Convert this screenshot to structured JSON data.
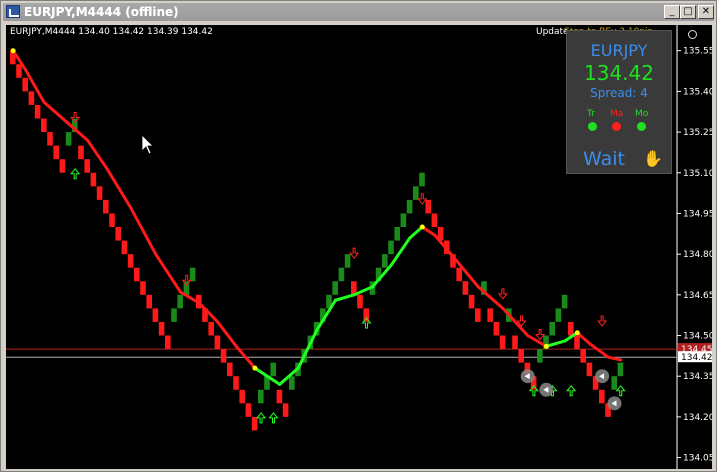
{
  "window": {
    "title": "EURJPY,M4444 (offline)",
    "buttons": {
      "minimize": "_",
      "maximize": "□",
      "close": "✕"
    }
  },
  "header_label": "EURJPY,M4444  134.40 134.42 134.39 134.42",
  "update_label": "Update",
  "update_overlay_text": "Stop to BEv 3 10pip",
  "panel": {
    "symbol": "EURJPY",
    "price": "134.42",
    "spread": "Spread: 4",
    "indicators": [
      {
        "label": "Tr",
        "color": "#1fe01f"
      },
      {
        "label": "Ma",
        "color": "#ff2020"
      },
      {
        "label": "Mo",
        "color": "#1fe01f"
      }
    ],
    "status": "Wait",
    "status_icon": "hand-icon"
  },
  "current_price_label": "134.42",
  "level_label": "134.45",
  "colors": {
    "bull": "#1a8a1a",
    "bear": "#ff1a1a",
    "ma_down": "#ff1a1a",
    "ma_up": "#22ff22",
    "ma_turn": "#ffff00",
    "panel_bg": "#3a3a3a",
    "accent_blue": "#3b8ef0",
    "accent_green": "#1fe01f"
  },
  "chart_data": {
    "type": "renko",
    "symbol": "EURJPY",
    "timeframe": "M4444",
    "ylim": [
      134.03,
      135.63
    ],
    "y_ticks": [
      "135.55",
      "135.40",
      "135.25",
      "135.10",
      "134.95",
      "134.80",
      "134.65",
      "134.50",
      "134.35",
      "134.20",
      "134.05"
    ],
    "brick_size": 0.05,
    "bricks": [
      {
        "dir": "down",
        "open": 135.55,
        "close": 135.5
      },
      {
        "dir": "down",
        "open": 135.5,
        "close": 135.45
      },
      {
        "dir": "down",
        "open": 135.45,
        "close": 135.4
      },
      {
        "dir": "down",
        "open": 135.4,
        "close": 135.35
      },
      {
        "dir": "down",
        "open": 135.35,
        "close": 135.3
      },
      {
        "dir": "down",
        "open": 135.3,
        "close": 135.25
      },
      {
        "dir": "down",
        "open": 135.25,
        "close": 135.2
      },
      {
        "dir": "down",
        "open": 135.2,
        "close": 135.15
      },
      {
        "dir": "down",
        "open": 135.15,
        "close": 135.1
      },
      {
        "dir": "up",
        "open": 135.2,
        "close": 135.25
      },
      {
        "dir": "up",
        "open": 135.25,
        "close": 135.3
      },
      {
        "dir": "down",
        "open": 135.2,
        "close": 135.15
      },
      {
        "dir": "down",
        "open": 135.15,
        "close": 135.1
      },
      {
        "dir": "down",
        "open": 135.1,
        "close": 135.05
      },
      {
        "dir": "down",
        "open": 135.05,
        "close": 135.0
      },
      {
        "dir": "down",
        "open": 135.0,
        "close": 134.95
      },
      {
        "dir": "down",
        "open": 134.95,
        "close": 134.9
      },
      {
        "dir": "down",
        "open": 134.9,
        "close": 134.85
      },
      {
        "dir": "down",
        "open": 134.85,
        "close": 134.8
      },
      {
        "dir": "down",
        "open": 134.8,
        "close": 134.75
      },
      {
        "dir": "down",
        "open": 134.75,
        "close": 134.7
      },
      {
        "dir": "down",
        "open": 134.7,
        "close": 134.65
      },
      {
        "dir": "down",
        "open": 134.65,
        "close": 134.6
      },
      {
        "dir": "down",
        "open": 134.6,
        "close": 134.55
      },
      {
        "dir": "down",
        "open": 134.55,
        "close": 134.5
      },
      {
        "dir": "down",
        "open": 134.5,
        "close": 134.45
      },
      {
        "dir": "up",
        "open": 134.55,
        "close": 134.6
      },
      {
        "dir": "up",
        "open": 134.6,
        "close": 134.65
      },
      {
        "dir": "up",
        "open": 134.65,
        "close": 134.7
      },
      {
        "dir": "up",
        "open": 134.7,
        "close": 134.75
      },
      {
        "dir": "down",
        "open": 134.65,
        "close": 134.6
      },
      {
        "dir": "down",
        "open": 134.6,
        "close": 134.55
      },
      {
        "dir": "down",
        "open": 134.55,
        "close": 134.5
      },
      {
        "dir": "down",
        "open": 134.5,
        "close": 134.45
      },
      {
        "dir": "down",
        "open": 134.45,
        "close": 134.4
      },
      {
        "dir": "down",
        "open": 134.4,
        "close": 134.35
      },
      {
        "dir": "down",
        "open": 134.35,
        "close": 134.3
      },
      {
        "dir": "down",
        "open": 134.3,
        "close": 134.25
      },
      {
        "dir": "down",
        "open": 134.25,
        "close": 134.2
      },
      {
        "dir": "down",
        "open": 134.2,
        "close": 134.15
      },
      {
        "dir": "up",
        "open": 134.25,
        "close": 134.3
      },
      {
        "dir": "up",
        "open": 134.3,
        "close": 134.35
      },
      {
        "dir": "up",
        "open": 134.35,
        "close": 134.4
      },
      {
        "dir": "down",
        "open": 134.3,
        "close": 134.25
      },
      {
        "dir": "down",
        "open": 134.25,
        "close": 134.2
      },
      {
        "dir": "up",
        "open": 134.3,
        "close": 134.35
      },
      {
        "dir": "up",
        "open": 134.35,
        "close": 134.4
      },
      {
        "dir": "up",
        "open": 134.4,
        "close": 134.45
      },
      {
        "dir": "up",
        "open": 134.45,
        "close": 134.5
      },
      {
        "dir": "up",
        "open": 134.5,
        "close": 134.55
      },
      {
        "dir": "up",
        "open": 134.55,
        "close": 134.6
      },
      {
        "dir": "up",
        "open": 134.6,
        "close": 134.65
      },
      {
        "dir": "up",
        "open": 134.65,
        "close": 134.7
      },
      {
        "dir": "up",
        "open": 134.7,
        "close": 134.75
      },
      {
        "dir": "up",
        "open": 134.75,
        "close": 134.8
      },
      {
        "dir": "down",
        "open": 134.7,
        "close": 134.65
      },
      {
        "dir": "down",
        "open": 134.65,
        "close": 134.6
      },
      {
        "dir": "down",
        "open": 134.6,
        "close": 134.55
      },
      {
        "dir": "up",
        "open": 134.65,
        "close": 134.7
      },
      {
        "dir": "up",
        "open": 134.7,
        "close": 134.75
      },
      {
        "dir": "up",
        "open": 134.75,
        "close": 134.8
      },
      {
        "dir": "up",
        "open": 134.8,
        "close": 134.85
      },
      {
        "dir": "up",
        "open": 134.85,
        "close": 134.9
      },
      {
        "dir": "up",
        "open": 134.9,
        "close": 134.95
      },
      {
        "dir": "up",
        "open": 134.95,
        "close": 135.0
      },
      {
        "dir": "up",
        "open": 135.0,
        "close": 135.05
      },
      {
        "dir": "up",
        "open": 135.05,
        "close": 135.1
      },
      {
        "dir": "down",
        "open": 135.0,
        "close": 134.95
      },
      {
        "dir": "down",
        "open": 134.95,
        "close": 134.9
      },
      {
        "dir": "down",
        "open": 134.9,
        "close": 134.85
      },
      {
        "dir": "down",
        "open": 134.85,
        "close": 134.8
      },
      {
        "dir": "down",
        "open": 134.8,
        "close": 134.75
      },
      {
        "dir": "down",
        "open": 134.75,
        "close": 134.7
      },
      {
        "dir": "down",
        "open": 134.7,
        "close": 134.65
      },
      {
        "dir": "down",
        "open": 134.65,
        "close": 134.6
      },
      {
        "dir": "down",
        "open": 134.6,
        "close": 134.55
      },
      {
        "dir": "up",
        "open": 134.65,
        "close": 134.7
      },
      {
        "dir": "down",
        "open": 134.6,
        "close": 134.55
      },
      {
        "dir": "down",
        "open": 134.55,
        "close": 134.5
      },
      {
        "dir": "down",
        "open": 134.5,
        "close": 134.45
      },
      {
        "dir": "up",
        "open": 134.55,
        "close": 134.6
      },
      {
        "dir": "down",
        "open": 134.5,
        "close": 134.45
      },
      {
        "dir": "down",
        "open": 134.45,
        "close": 134.4
      },
      {
        "dir": "down",
        "open": 134.4,
        "close": 134.35
      },
      {
        "dir": "down",
        "open": 134.35,
        "close": 134.3
      },
      {
        "dir": "up",
        "open": 134.4,
        "close": 134.45
      },
      {
        "dir": "up",
        "open": 134.45,
        "close": 134.5
      },
      {
        "dir": "up",
        "open": 134.5,
        "close": 134.55
      },
      {
        "dir": "up",
        "open": 134.55,
        "close": 134.6
      },
      {
        "dir": "up",
        "open": 134.6,
        "close": 134.65
      },
      {
        "dir": "down",
        "open": 134.55,
        "close": 134.5
      },
      {
        "dir": "down",
        "open": 134.5,
        "close": 134.45
      },
      {
        "dir": "down",
        "open": 134.45,
        "close": 134.4
      },
      {
        "dir": "down",
        "open": 134.4,
        "close": 134.35
      },
      {
        "dir": "down",
        "open": 134.35,
        "close": 134.3
      },
      {
        "dir": "down",
        "open": 134.3,
        "close": 134.25
      },
      {
        "dir": "down",
        "open": 134.25,
        "close": 134.2
      },
      {
        "dir": "up",
        "open": 134.3,
        "close": 134.35
      },
      {
        "dir": "up",
        "open": 134.35,
        "close": 134.4
      }
    ],
    "moving_average": [
      {
        "i": 0,
        "y": 135.55,
        "c": "up"
      },
      {
        "i": 2,
        "y": 135.48,
        "c": "down"
      },
      {
        "i": 5,
        "y": 135.36,
        "c": "down"
      },
      {
        "i": 9,
        "y": 135.28,
        "c": "down"
      },
      {
        "i": 12,
        "y": 135.22,
        "c": "down"
      },
      {
        "i": 15,
        "y": 135.12,
        "c": "down"
      },
      {
        "i": 19,
        "y": 134.97,
        "c": "down"
      },
      {
        "i": 23,
        "y": 134.8,
        "c": "down"
      },
      {
        "i": 27,
        "y": 134.66,
        "c": "down"
      },
      {
        "i": 30,
        "y": 134.62,
        "c": "down"
      },
      {
        "i": 33,
        "y": 134.55,
        "c": "down"
      },
      {
        "i": 36,
        "y": 134.46,
        "c": "down"
      },
      {
        "i": 39,
        "y": 134.38,
        "c": "down"
      },
      {
        "i": 43,
        "y": 134.32,
        "c": "up"
      },
      {
        "i": 46,
        "y": 134.38,
        "c": "up"
      },
      {
        "i": 49,
        "y": 134.52,
        "c": "up"
      },
      {
        "i": 52,
        "y": 134.63,
        "c": "up"
      },
      {
        "i": 55,
        "y": 134.65,
        "c": "up"
      },
      {
        "i": 58,
        "y": 134.68,
        "c": "up"
      },
      {
        "i": 61,
        "y": 134.76,
        "c": "up"
      },
      {
        "i": 64,
        "y": 134.86,
        "c": "up"
      },
      {
        "i": 66,
        "y": 134.9,
        "c": "up"
      },
      {
        "i": 68,
        "y": 134.87,
        "c": "down"
      },
      {
        "i": 71,
        "y": 134.79,
        "c": "down"
      },
      {
        "i": 75,
        "y": 134.68,
        "c": "down"
      },
      {
        "i": 79,
        "y": 134.6,
        "c": "down"
      },
      {
        "i": 83,
        "y": 134.5,
        "c": "down"
      },
      {
        "i": 86,
        "y": 134.46,
        "c": "down"
      },
      {
        "i": 89,
        "y": 134.48,
        "c": "up"
      },
      {
        "i": 91,
        "y": 134.51,
        "c": "up"
      },
      {
        "i": 93,
        "y": 134.47,
        "c": "down"
      },
      {
        "i": 96,
        "y": 134.42,
        "c": "down"
      },
      {
        "i": 98,
        "y": 134.41,
        "c": "down"
      }
    ],
    "signals": [
      {
        "i": 10,
        "type": "down",
        "price": 135.3
      },
      {
        "i": 10,
        "type": "up",
        "price": 135.1
      },
      {
        "i": 28,
        "type": "down",
        "price": 134.7
      },
      {
        "i": 40,
        "type": "up",
        "price": 134.2
      },
      {
        "i": 42,
        "type": "up",
        "price": 134.2
      },
      {
        "i": 55,
        "type": "down",
        "price": 134.8
      },
      {
        "i": 57,
        "type": "up",
        "price": 134.55
      },
      {
        "i": 66,
        "type": "down",
        "price": 135.0
      },
      {
        "i": 79,
        "type": "down",
        "price": 134.65
      },
      {
        "i": 82,
        "type": "down",
        "price": 134.55
      },
      {
        "i": 85,
        "type": "down",
        "price": 134.5
      },
      {
        "i": 84,
        "type": "up",
        "price": 134.3
      },
      {
        "i": 87,
        "type": "up",
        "price": 134.3
      },
      {
        "i": 90,
        "type": "up",
        "price": 134.3
      },
      {
        "i": 95,
        "type": "down",
        "price": 134.55
      },
      {
        "i": 98,
        "type": "up",
        "price": 134.3
      }
    ],
    "markers": [
      {
        "i": 83,
        "price": 134.35
      },
      {
        "i": 86,
        "price": 134.3
      },
      {
        "i": 95,
        "price": 134.35
      },
      {
        "i": 97,
        "price": 134.25
      }
    ],
    "hlines": [
      {
        "price": 134.45,
        "color": "#b02020"
      },
      {
        "price": 134.42,
        "color": "#b0b0b0"
      }
    ]
  }
}
